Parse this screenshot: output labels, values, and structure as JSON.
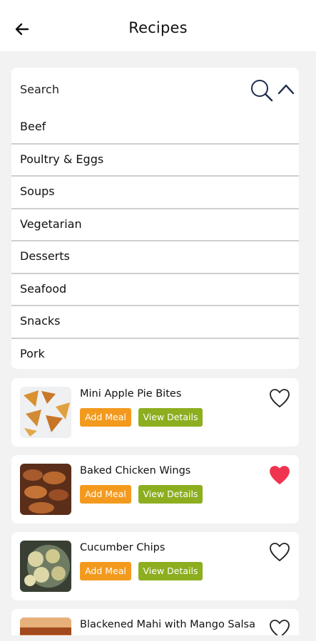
{
  "header": {
    "title": "Recipes"
  },
  "search": {
    "label": "Search"
  },
  "categories": [
    "Beef",
    "Poultry & Eggs",
    "Soups",
    "Vegetarian",
    "Desserts",
    "Seafood",
    "Snacks",
    "Pork"
  ],
  "recipes": [
    {
      "name": "Mini Apple Pie Bites",
      "add_label": "Add Meal",
      "view_label": "View Details",
      "favorite": false
    },
    {
      "name": "Baked Chicken Wings",
      "add_label": "Add Meal",
      "view_label": "View Details",
      "favorite": true
    },
    {
      "name": "Cucumber Chips",
      "add_label": "Add Meal",
      "view_label": "View Details",
      "favorite": false
    },
    {
      "name": "Blackened Mahi with Mango Salsa",
      "add_label": "",
      "view_label": "",
      "favorite": false
    }
  ],
  "colors": {
    "add_button": "#f39a1e",
    "view_button": "#8cae1f",
    "favorite_heart": "#f0344f"
  },
  "icons": {
    "back": "arrow-left-icon",
    "search": "search-icon",
    "collapse": "chevron-up-icon",
    "favorite": "heart-icon"
  }
}
